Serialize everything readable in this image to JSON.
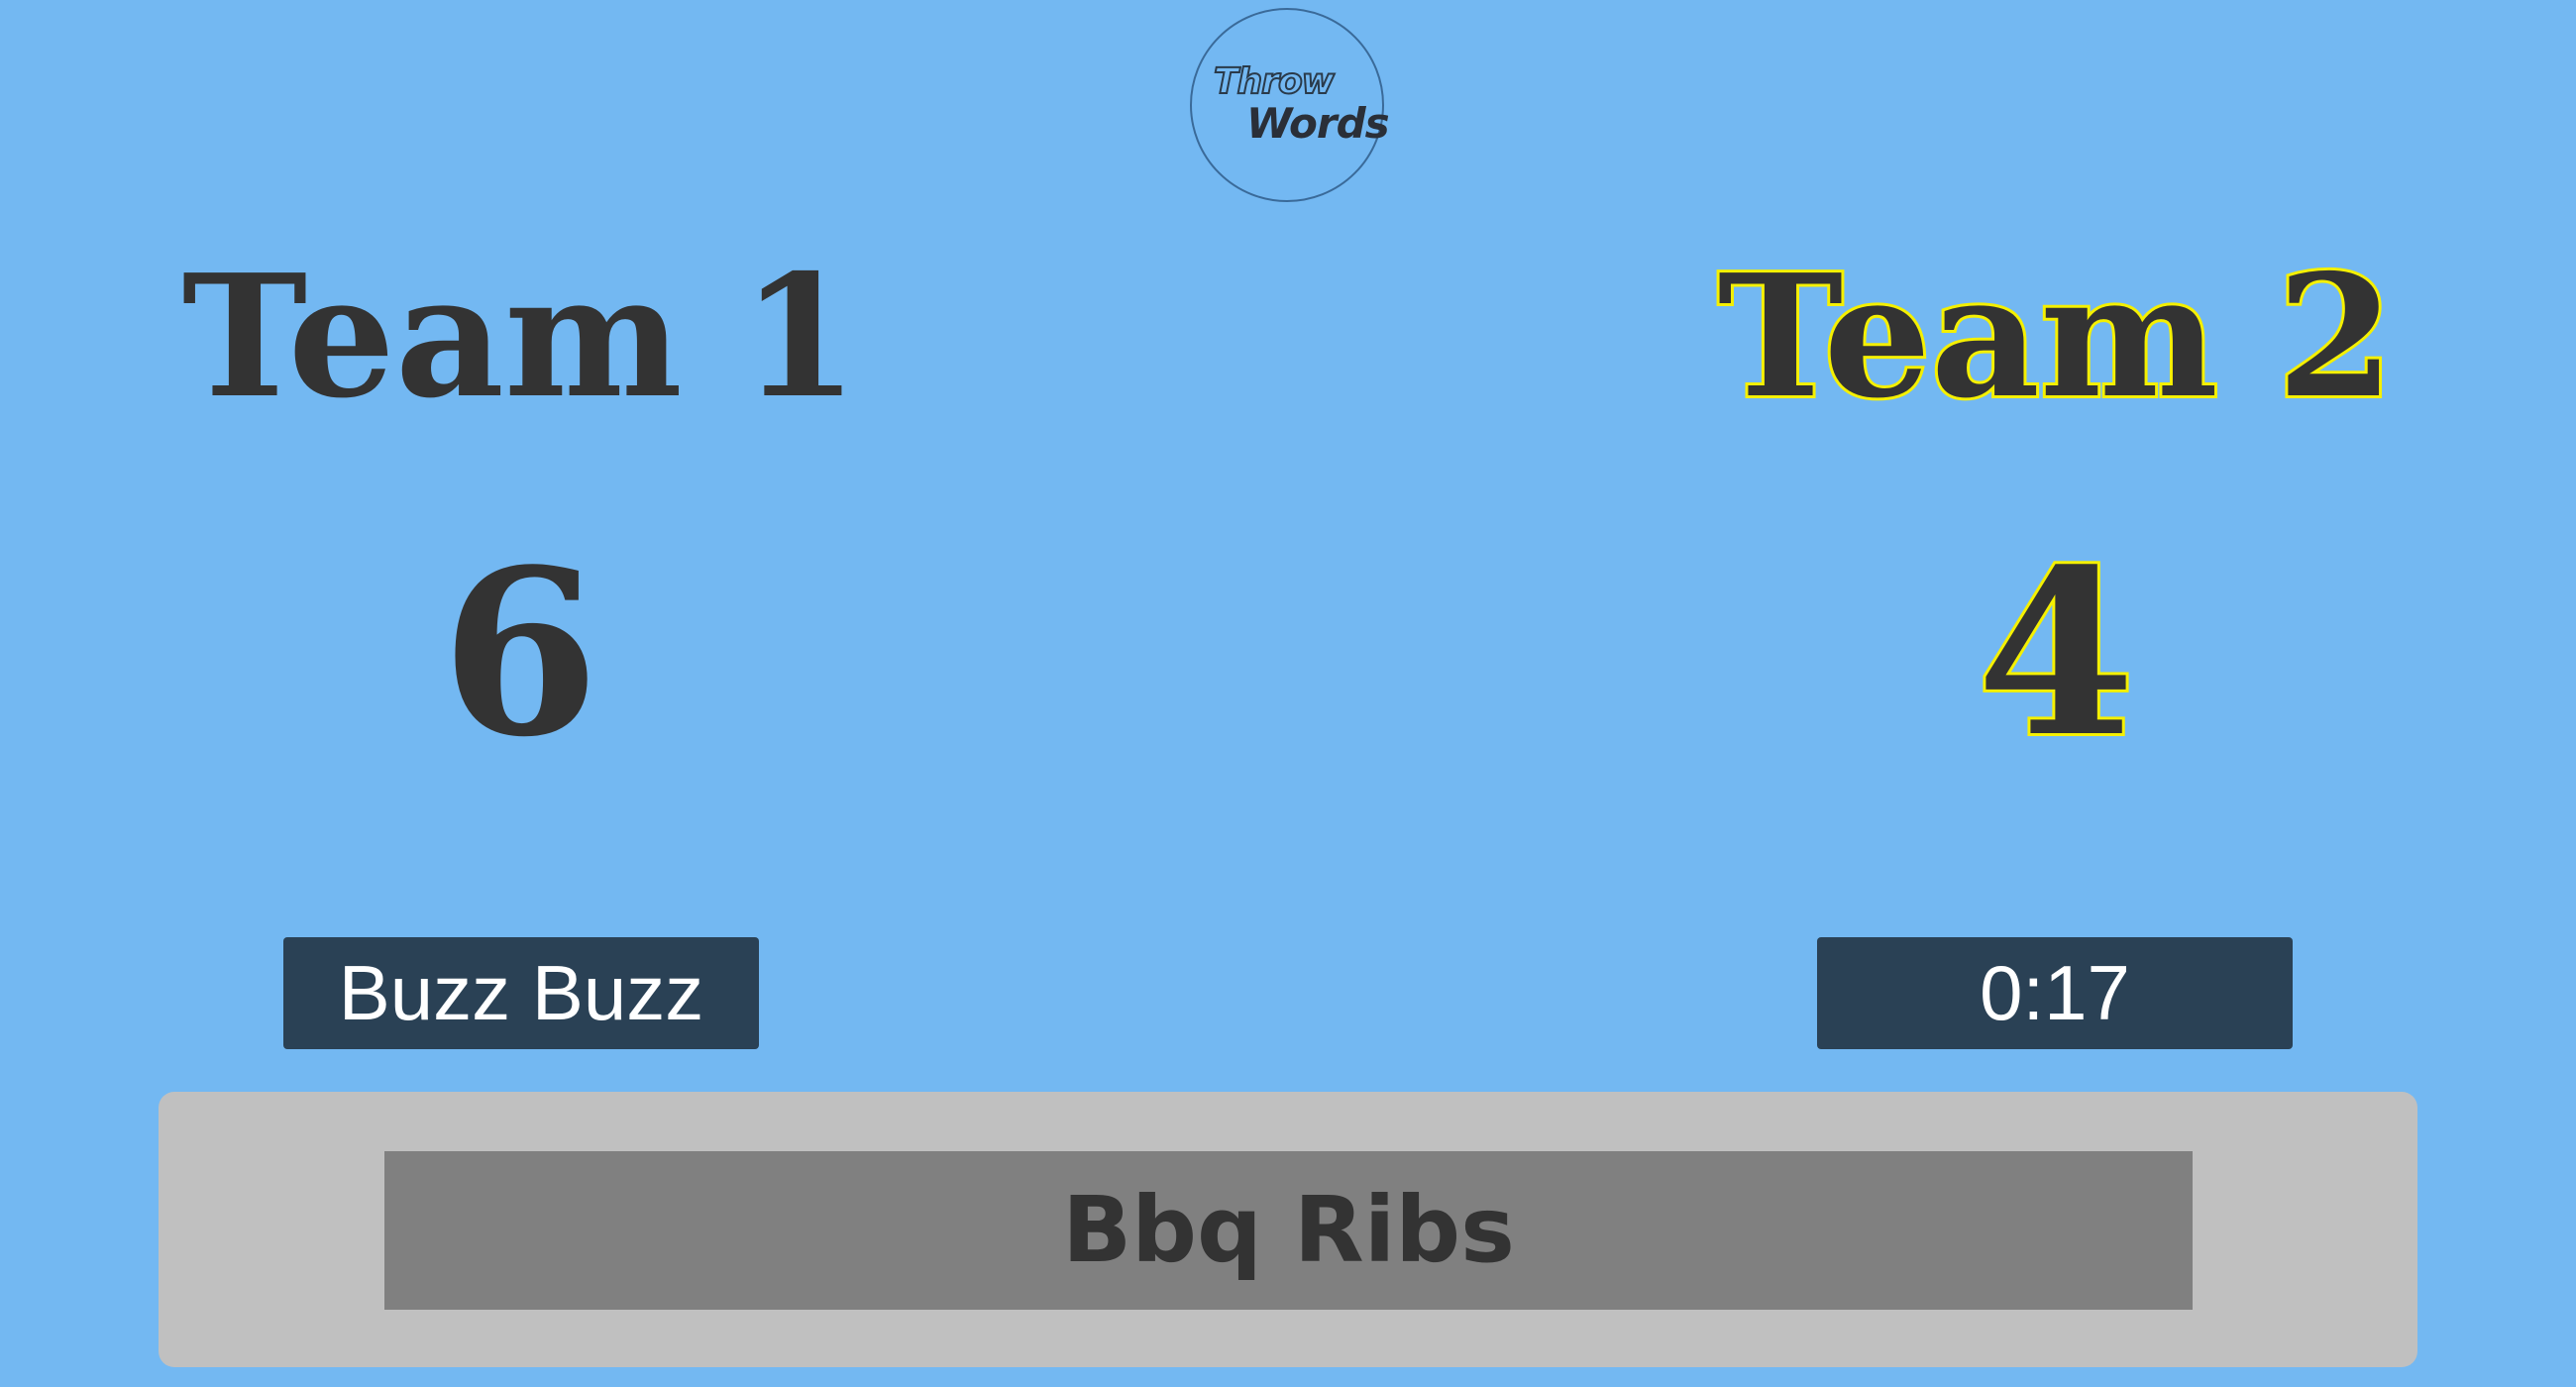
{
  "logo": {
    "line1": "Throw",
    "line2": "Words"
  },
  "teams": [
    {
      "name": "Team 1",
      "score": "6",
      "active": false
    },
    {
      "name": "Team 2",
      "score": "4",
      "active": true
    }
  ],
  "controls": {
    "buzz_label": "Buzz Buzz",
    "timer": "0:17"
  },
  "word": "Bbq Ribs",
  "colors": {
    "background": "#73b8f2",
    "active_outline": "#f5f000",
    "text": "#333333",
    "button": "#2a4155",
    "panel": "#c0c0c0",
    "word_box": "#808080"
  }
}
